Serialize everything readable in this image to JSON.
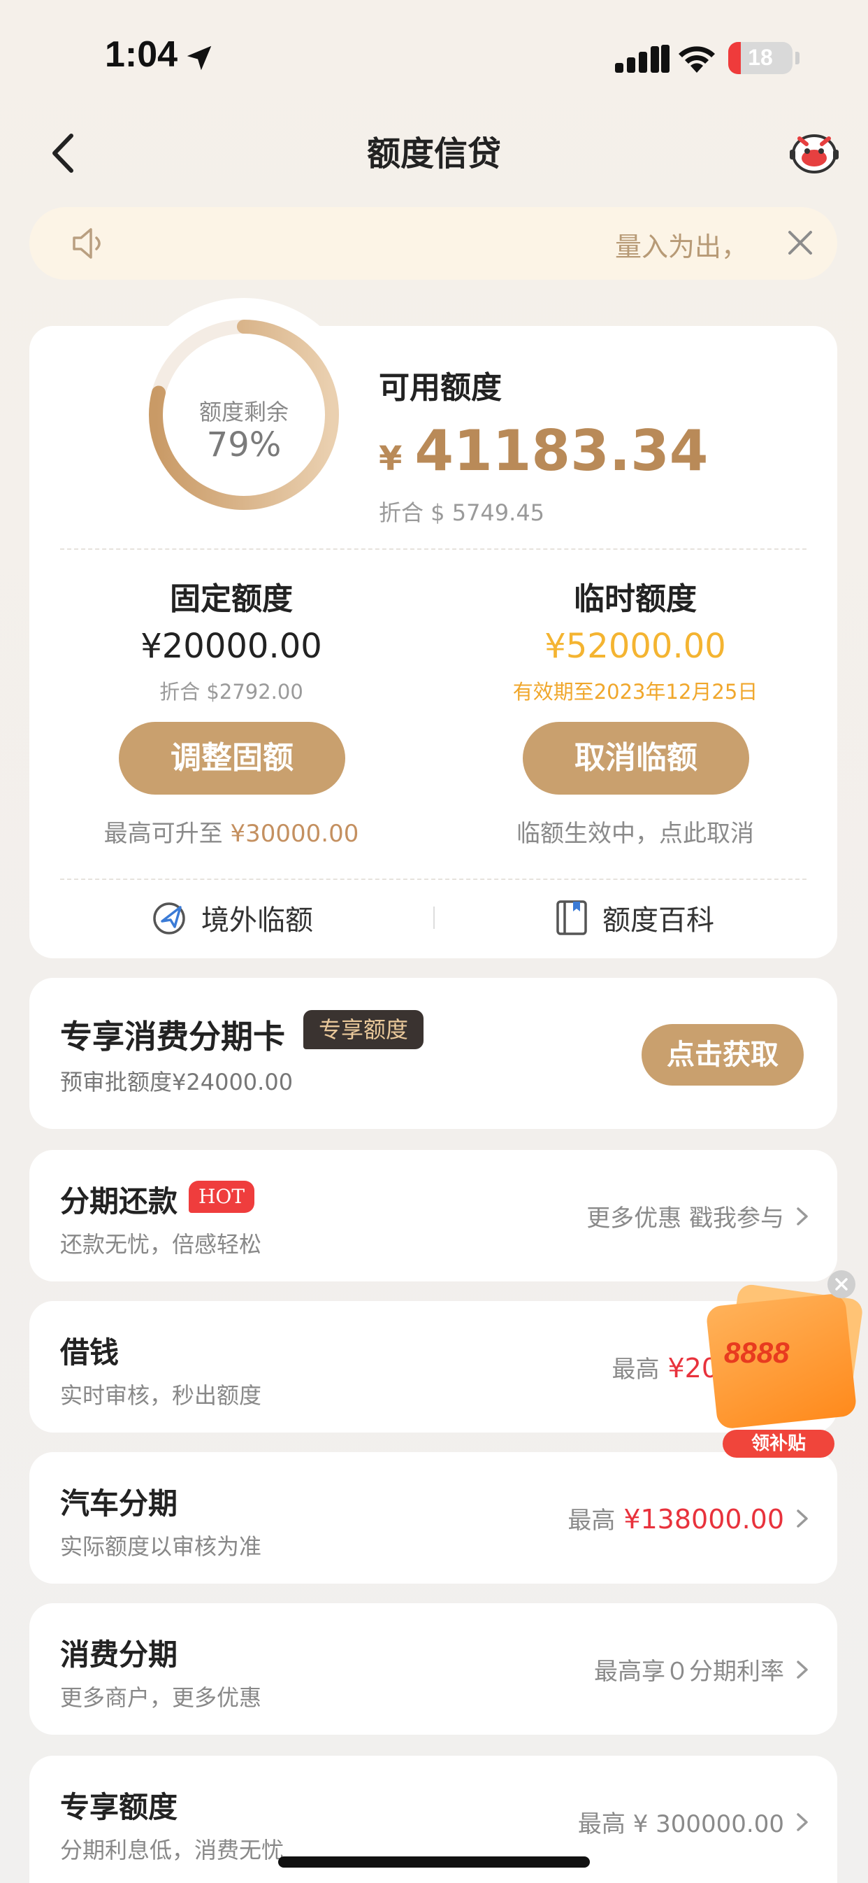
{
  "status_bar": {
    "time": "1:04",
    "battery": "18"
  },
  "nav": {
    "title": "额度信贷"
  },
  "notice": {
    "text": "量入为出，"
  },
  "credit": {
    "ring_label": "额度剩余",
    "ring_percent": "79%",
    "ring_fraction": 0.79,
    "available_title": "可用额度",
    "currency": "¥",
    "available_amount": "41183.34",
    "available_usd": "折合 $ 5749.45",
    "fixed": {
      "title": "固定额度",
      "amount": "¥20000.00",
      "sub": "折合 $2792.00",
      "button": "调整固额",
      "hint_prefix": "最高可升至 ",
      "hint_amount": "¥30000.00"
    },
    "temp": {
      "title": "临时额度",
      "amount": "¥52000.00",
      "sub": "有效期至2023年12月25日",
      "button": "取消临额",
      "hint": "临额生效中，点此取消"
    },
    "links": {
      "overseas": "境外临额",
      "encyclopedia": "额度百科"
    }
  },
  "exclusive_card": {
    "title": "专享消费分期卡",
    "badge": "专享额度",
    "sub": "预审批额度¥24000.00",
    "button": "点击获取"
  },
  "rows": [
    {
      "title": "分期还款",
      "badge": "HOT",
      "sub": "还款无忧，倍感轻松",
      "right": "更多优惠 戳我参与",
      "right_value": ""
    },
    {
      "title": "借钱",
      "badge": "",
      "sub": "实时审核，秒出额度",
      "right": "最高",
      "right_value": "¥20"
    },
    {
      "title": "汽车分期",
      "badge": "",
      "sub": "实际额度以审核为准",
      "right": "最高",
      "right_value": "¥138000.00"
    },
    {
      "title": "消费分期",
      "badge": "",
      "sub": "更多商户，更多优惠",
      "right": "最高享０分期利率",
      "right_value": ""
    },
    {
      "title": "专享额度",
      "badge": "",
      "sub": "分期利息低，消费无忧",
      "right": "最高 ¥ 300000.00",
      "right_value": ""
    }
  ],
  "promo": {
    "amount": "8888",
    "label": "领补贴"
  },
  "colors": {
    "accent_gold": "#c9a06e",
    "amount_gold": "#b98a58",
    "temp_yellow": "#f4b431",
    "red": "#e8323c"
  }
}
